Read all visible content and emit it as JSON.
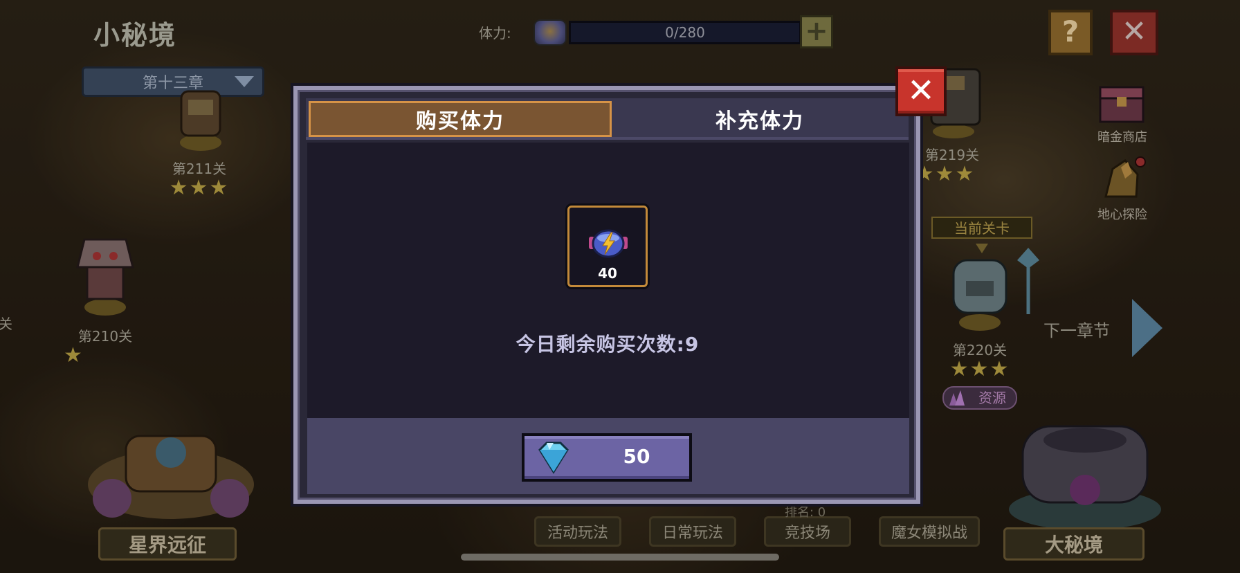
{
  "header": {
    "page_title": "小秘境",
    "chapter_select": "第十三章",
    "stamina_label": "体力:",
    "stamina_value": "0/280",
    "plus_label": "+",
    "help_label": "?",
    "close_label": "✕"
  },
  "side_menu": {
    "items": [
      {
        "label": "暗金商店",
        "icon": "treasure-chest-icon"
      },
      {
        "label": "地心探险",
        "icon": "crystal-icon"
      }
    ]
  },
  "stages": {
    "items": [
      {
        "label": "第211关",
        "stars": "★★★"
      },
      {
        "label": "第210关",
        "stars": "★"
      },
      {
        "label": "第219关",
        "stars": "★★★"
      },
      {
        "label": "第220关",
        "stars": "★★★"
      }
    ],
    "left_partial_label": "关",
    "current_tag": "当前关卡",
    "next_chapter": "下一章节",
    "resource_tag": "资源"
  },
  "bottom_nav": {
    "left_big": "星界远征",
    "right_big": "大秘境",
    "buttons": [
      "活动玩法",
      "日常玩法",
      "竞技场",
      "魔女模拟战"
    ],
    "rank_text": "排名: 0"
  },
  "modal": {
    "tabs": [
      {
        "label": "购买体力",
        "active": true
      },
      {
        "label": "补充体力",
        "active": false
      }
    ],
    "item": {
      "icon": "energy-potion-icon",
      "count": "40"
    },
    "remaining_text": "今日剩余购买次数:9",
    "buy_price": "50",
    "buy_currency_icon": "diamond-icon",
    "close_label": "✕"
  },
  "colors": {
    "tab_active": "#7a5532",
    "tab_active_border": "#d69347",
    "close_red": "#c8342c",
    "buy_button": "#6c64a4",
    "modal_border": "#9b97b4"
  }
}
